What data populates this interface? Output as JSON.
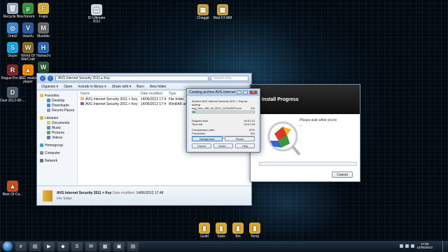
{
  "desktop": {
    "icons_left": [
      {
        "label": "Recycle Bin",
        "glyph": "🗑",
        "color": "#9db4c8"
      },
      {
        "label": "Orbit2",
        "glyph": "◎",
        "color": "#3a8bd8"
      },
      {
        "label": "Skype",
        "glyph": "S",
        "color": "#10a9e8"
      },
      {
        "label": "Rogue Pro 3.0",
        "glyph": "R",
        "color": "#7a2a2a"
      },
      {
        "label": "Dust\n2012-08-...",
        "glyph": "D",
        "color": "#4d5e6e"
      },
      {
        "label": "Best Of Ca...",
        "glyph": "▲",
        "color": "#c74a20"
      }
    ],
    "icons_col2": [
      {
        "label": "uTorrent",
        "glyph": "µ",
        "color": "#2c9a3a"
      },
      {
        "label": "VeiaVu",
        "glyph": "V",
        "color": "#2a5d9c"
      },
      {
        "label": "World Of WarCraft",
        "glyph": "W",
        "color": "#8a6a2a"
      },
      {
        "label": "VLC media player",
        "glyph": "▲",
        "color": "#ee8800"
      }
    ],
    "icons_col3": [
      {
        "label": "Fraps",
        "glyph": "F",
        "color": "#d8b030"
      },
      {
        "label": "Mumble",
        "glyph": "M",
        "color": "#6a6a6a"
      },
      {
        "label": "Hamachi",
        "glyph": "H",
        "color": "#2a6ab0"
      },
      {
        "label": "W",
        "glyph": "W",
        "color": "#2d5d3a"
      }
    ],
    "icons_top": [
      {
        "label": "ID Ultimate 2011",
        "glyph": "▤",
        "color": "#d0d8e0"
      },
      {
        "label": "Cheggit",
        "glyph": "▦",
        "color": "#c8a040"
      },
      {
        "label": "Mod F3 MM",
        "glyph": "▦",
        "color": "#c8a040"
      }
    ],
    "icons_bottom": [
      {
        "label": "Guild",
        "glyph": "▮",
        "color": "#d8a830"
      },
      {
        "label": "Stats",
        "glyph": "▮",
        "color": "#d8a830"
      },
      {
        "label": "Bin",
        "glyph": "▮",
        "color": "#d8a830"
      },
      {
        "label": "Temp",
        "glyph": "▮",
        "color": "#d8a830"
      }
    ]
  },
  "explorer": {
    "address": "AVG Internet Security 2011 ▸ Key",
    "search_placeholder": "Search Key",
    "toolbar": [
      "Organize ▾",
      "Open",
      "Include in library ▾",
      "Share with ▾",
      "Burn",
      "New folder"
    ],
    "sidebar": {
      "favorites": "Favorites",
      "favorite_items": [
        "Desktop",
        "Downloads",
        "Recent Places"
      ],
      "libraries": "Libraries",
      "library_items": [
        "Documents",
        "Music",
        "Pictures",
        "Videos"
      ],
      "homegroup": "Homegroup",
      "computer": "Computer",
      "network": "Network"
    },
    "columns": [
      "Name",
      "Date modified",
      "Type"
    ],
    "rows": [
      {
        "name": "AVG Internet Security 2011 + Key",
        "date": "14/06/2012 17:48",
        "type": "File folder"
      },
      {
        "name": "AVG Internet Security 2011 + Key",
        "date": "14/06/2012 17:48",
        "type": "WinRAR archive"
      }
    ],
    "details": {
      "name": "AVG Internet Security 2011 + Key",
      "date_label": "Date modified:",
      "date": "14/06/2012 17:48",
      "type": "File folder"
    }
  },
  "installer": {
    "heading": "Install Progress",
    "text1": "Please wait while you're",
    "text2": "...",
    "cancel": "Cancel"
  },
  "dialog": {
    "title": "Creating archive AVG Internet S...",
    "archive_line": "Archive AVG Internet Security 2011 + Key.rar",
    "adding_label": "adding",
    "adding_file": "avg_isec_x86_all_2011_1120a3023.exe",
    "adding_pct": "4%",
    "file_progress": 0.04,
    "elapsed_label": "Elapsed time",
    "elapsed": "00:01:12",
    "timeleft_label": "Time left",
    "timeleft": "00:07:25",
    "ratio_label": "Compression ratio",
    "ratio": "87%",
    "processed_label": "Processed",
    "processed": "8%",
    "total_progress": 0.08,
    "buttons": [
      "Background",
      "Pause",
      "Cancel",
      "Mode...",
      "Help"
    ]
  },
  "taskbar": {
    "apps": [
      "e",
      "▤",
      "▶",
      "◆",
      "S",
      "✉",
      "▦",
      "▣",
      "▤"
    ],
    "time": "17:56",
    "date": "14/06/2012"
  }
}
